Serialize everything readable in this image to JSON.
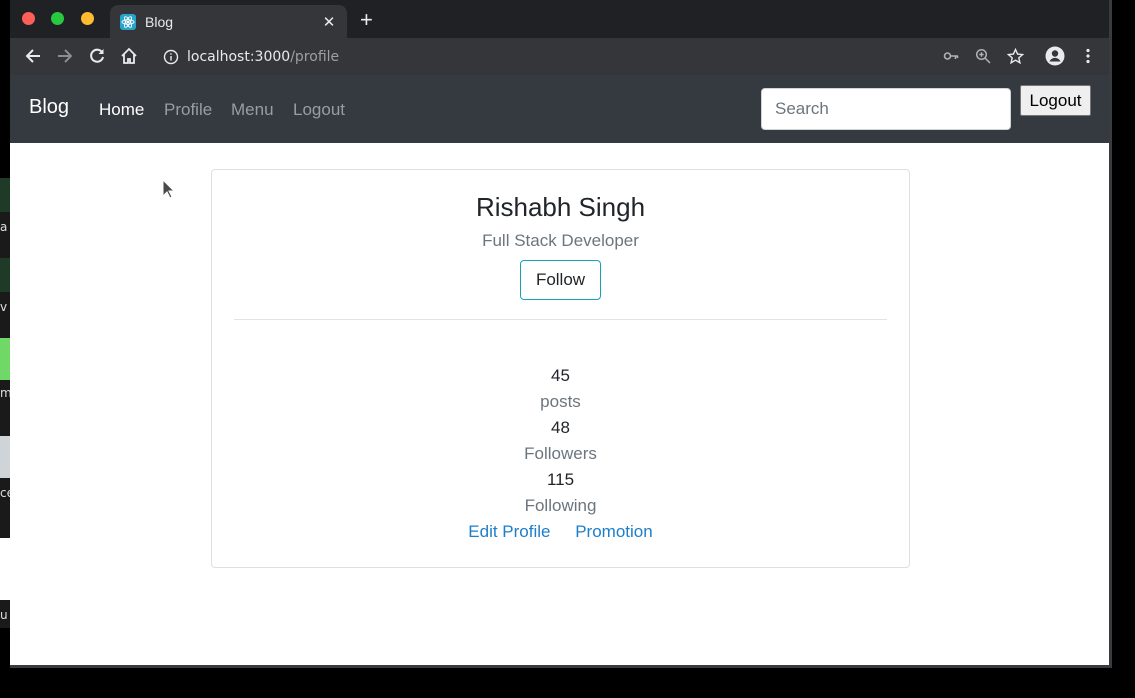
{
  "browser": {
    "tab_title": "Blog",
    "url_host": "localhost:3000",
    "url_path": "/profile"
  },
  "navbar": {
    "brand": "Blog",
    "links": [
      {
        "label": "Home"
      },
      {
        "label": "Profile"
      },
      {
        "label": "Menu"
      },
      {
        "label": "Logout"
      }
    ],
    "search_placeholder": "Search",
    "logout_button": "Logout"
  },
  "profile": {
    "name": "Rishabh Singh",
    "title": "Full Stack Developer",
    "follow_button": "Follow",
    "stats": [
      {
        "value": "45",
        "label": "posts"
      },
      {
        "value": "48",
        "label": "Followers"
      },
      {
        "value": "115",
        "label": "Following"
      }
    ],
    "links": {
      "edit_profile": "Edit Profile",
      "promotion": "Promotion"
    }
  },
  "background_window_fragments": [
    "a",
    "v",
    "m",
    "ce",
    "u"
  ],
  "colors": {
    "navbar_bg": "#343a40",
    "follow_border": "#17a2b8",
    "link": "#1e7ec8"
  }
}
